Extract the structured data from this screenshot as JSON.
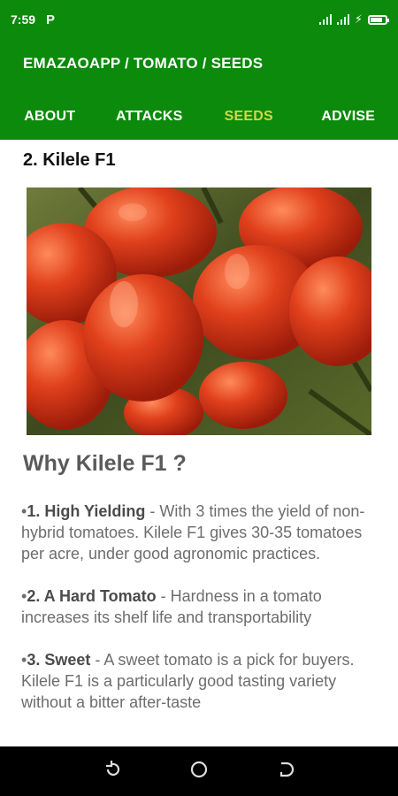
{
  "status_bar": {
    "time": "7:59",
    "carrier_icon": "p",
    "icons": [
      "signal-icon",
      "signal-icon",
      "battery-icon"
    ]
  },
  "app_bar": {
    "title": "EMAZAOAPP / TOMATO / SEEDS",
    "tabs": [
      {
        "label": "ABOUT"
      },
      {
        "label": "ATTACKS"
      },
      {
        "label": "SEEDS"
      },
      {
        "label": "ADVISE"
      }
    ]
  },
  "main": {
    "heading": "2. Kilele F1",
    "image_alt": "Kilele F1 tomatoes",
    "why_heading": "Why Kilele F1 ?",
    "bullets": [
      {
        "prefix": "•",
        "title": "1. High Yielding",
        "text": " - With 3 times the yield of non-hybrid tomatoes. Kilele F1 gives 30-35 tomatoes per acre, under good agronomic practices."
      },
      {
        "prefix": "•",
        "title": "2. A Hard Tomato",
        "text": " - Hardness in a tomato increases its shelf life and transportability"
      },
      {
        "prefix": "•",
        "title": "3. Sweet",
        "text": " - A sweet tomato is a pick for buyers. Kilele F1 is a particularly good tasting variety without a bitter after-taste"
      }
    ]
  },
  "colors": {
    "brand_green": "#0b8a0b",
    "active_tab": "#d4d64a"
  }
}
